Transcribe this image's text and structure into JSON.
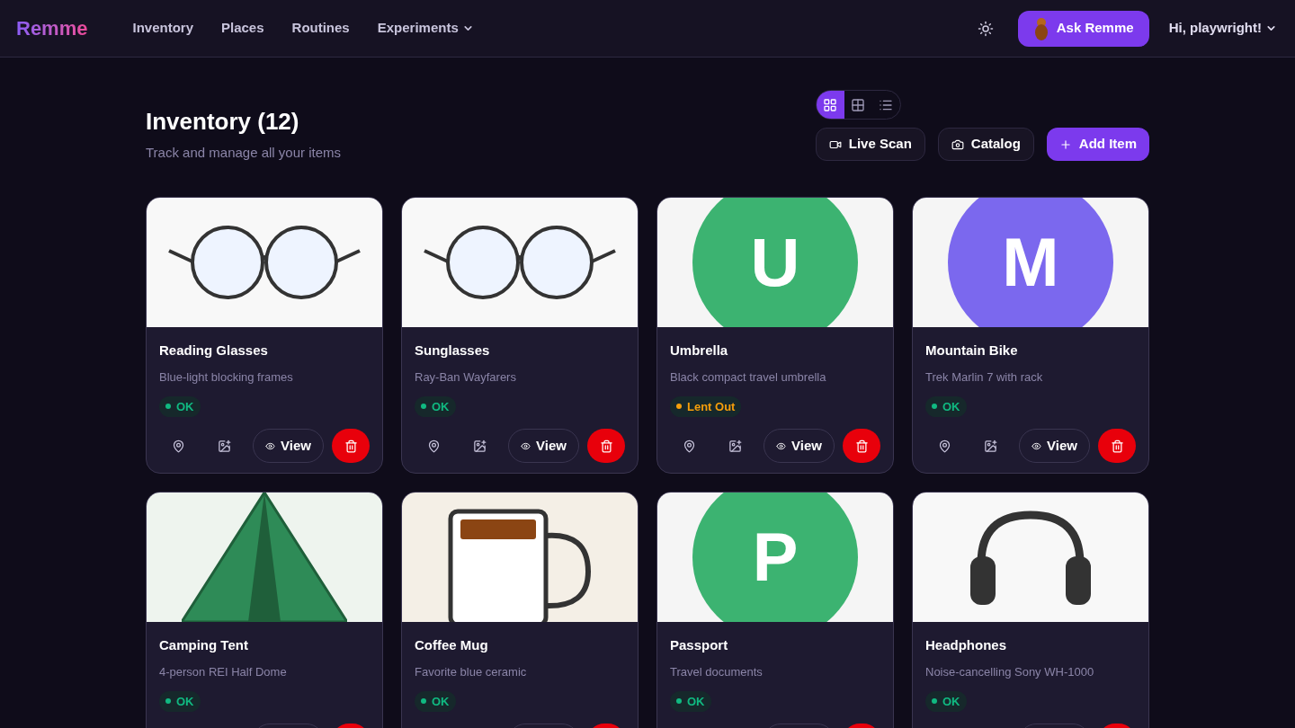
{
  "nav": {
    "logo": "Remme",
    "links": [
      {
        "label": "Inventory",
        "dropdown": false
      },
      {
        "label": "Places",
        "dropdown": false
      },
      {
        "label": "Routines",
        "dropdown": false
      },
      {
        "label": "Experiments",
        "dropdown": true
      }
    ],
    "ask_button": "Ask Remme",
    "user_menu": "Hi, playwright!"
  },
  "header": {
    "title": "Inventory (12)",
    "subtitle": "Track and manage all your items"
  },
  "view_modes": [
    {
      "kind": "cards",
      "selected": true
    },
    {
      "kind": "grid",
      "selected": false
    },
    {
      "kind": "list",
      "selected": false
    }
  ],
  "actions": [
    {
      "kind": "video",
      "label": "Live Scan"
    },
    {
      "kind": "camera",
      "label": "Catalog"
    },
    {
      "kind": "add",
      "label": "Add Item"
    }
  ],
  "items": [
    {
      "name": "Reading Glasses",
      "description": "Blue-light blocking frames",
      "status": {
        "label": "OK",
        "color": "#10b981"
      },
      "art": {
        "kind": "glasses"
      },
      "view": "View"
    },
    {
      "name": "Sunglasses",
      "description": "Ray-Ban Wayfarers",
      "status": {
        "label": "OK",
        "color": "#10b981"
      },
      "art": {
        "kind": "glasses"
      },
      "view": "View"
    },
    {
      "name": "Umbrella",
      "description": "Black compact travel umbrella",
      "status": {
        "label": "Lent Out",
        "color": "#f59e0b"
      },
      "art": {
        "kind": "letter",
        "letter": "U",
        "color": "#3cb371"
      },
      "view": "View"
    },
    {
      "name": "Mountain Bike",
      "description": "Trek Marlin 7 with rack",
      "status": {
        "label": "OK",
        "color": "#10b981"
      },
      "art": {
        "kind": "letter",
        "letter": "M",
        "color": "#7b68ee"
      },
      "view": "View"
    },
    {
      "name": "Camping Tent",
      "description": "4-person REI Half Dome",
      "status": {
        "label": "OK",
        "color": "#10b981"
      },
      "art": {
        "kind": "tent"
      }
    },
    {
      "name": "Coffee Mug",
      "description": "Favorite blue ceramic",
      "status": {
        "label": "OK",
        "color": "#10b981"
      },
      "art": {
        "kind": "mug"
      }
    },
    {
      "name": "Passport",
      "description": "Travel documents",
      "status": {
        "label": "OK",
        "color": "#10b981"
      },
      "art": {
        "kind": "letter",
        "letter": "P",
        "color": "#3cb371"
      }
    },
    {
      "name": "Headphones",
      "description": "Noise-cancelling Sony WH-1000",
      "status": {
        "label": "OK",
        "color": "#10b981"
      },
      "art": {
        "kind": "headphones"
      }
    }
  ]
}
